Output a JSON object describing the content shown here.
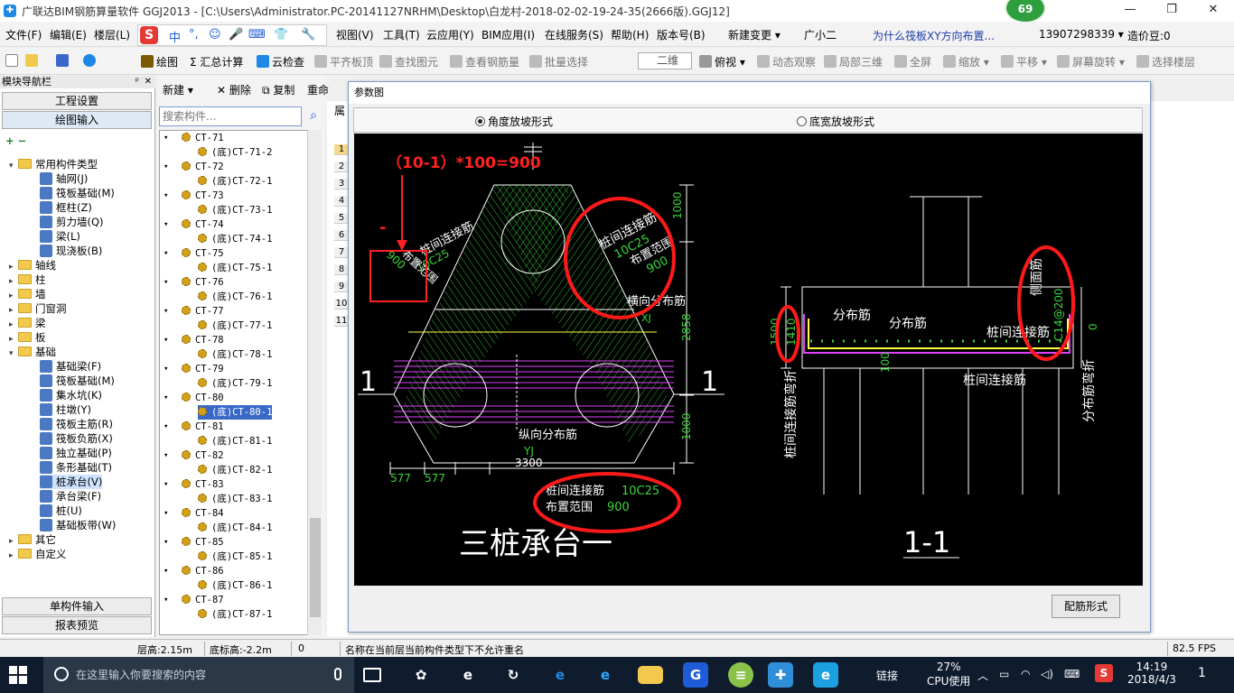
{
  "window": {
    "title": "广联达BIM钢筋算量软件 GGJ2013 - [C:\\Users\\Administrator.PC-20141127NRHM\\Desktop\\白龙村-2018-02-02-19-24-35(2666版).GGJ12]",
    "badge": "69",
    "minimize": "—",
    "maximize": "❐",
    "close": "✕"
  },
  "menu": {
    "items": [
      "文件(F)",
      "编辑(E)",
      "楼层(L)",
      "视图(V)",
      "工具(T)",
      "云应用(Y)",
      "BIM应用(I)",
      "在线服务(S)",
      "帮助(H)",
      "版本号(B)",
      "新建变更 ▾",
      "广小二"
    ],
    "ime": [
      "中",
      "°,",
      "☺",
      "🎤",
      "⌨",
      "👕",
      "🔧"
    ],
    "ime_logo": "S",
    "hint": "为什么筏板XY方向布置...",
    "phone": "13907298339 ▾",
    "cost_bean": "造价豆:0"
  },
  "toolbar": {
    "items": [
      "",
      "",
      "",
      "",
      "绘图",
      "Σ 汇总计算",
      "云检查",
      "平齐板顶",
      "查找图元",
      "查看钢筋量",
      "批量选择",
      "俯视 ▾",
      "动态观察",
      "局部三维",
      "全屏",
      "缩放 ▾",
      "平移 ▾",
      "屏幕旋转 ▾",
      "选择楼层"
    ],
    "view_mode": "二维"
  },
  "nav": {
    "header": "模块导航栏",
    "pin": "ᵖ",
    "close": "✕",
    "btn_project": "工程设置",
    "btn_draw": "绘图输入",
    "btn_single": "单构件输入",
    "btn_report": "报表预览",
    "expand_icons": "+ −",
    "tree": [
      {
        "label": "常用构件类型",
        "level": 0,
        "expanded": true,
        "folder": true
      },
      {
        "label": "轴网(J)",
        "level": 1
      },
      {
        "label": "筏板基础(M)",
        "level": 1
      },
      {
        "label": "框柱(Z)",
        "level": 1
      },
      {
        "label": "剪力墙(Q)",
        "level": 1
      },
      {
        "label": "梁(L)",
        "level": 1
      },
      {
        "label": "现浇板(B)",
        "level": 1
      },
      {
        "label": "轴线",
        "level": 0,
        "folder": true
      },
      {
        "label": "柱",
        "level": 0,
        "folder": true
      },
      {
        "label": "墙",
        "level": 0,
        "folder": true
      },
      {
        "label": "门窗洞",
        "level": 0,
        "folder": true
      },
      {
        "label": "梁",
        "level": 0,
        "folder": true
      },
      {
        "label": "板",
        "level": 0,
        "folder": true
      },
      {
        "label": "基础",
        "level": 0,
        "expanded": true,
        "folder": true
      },
      {
        "label": "基础梁(F)",
        "level": 1
      },
      {
        "label": "筏板基础(M)",
        "level": 1
      },
      {
        "label": "集水坑(K)",
        "level": 1
      },
      {
        "label": "柱墩(Y)",
        "level": 1
      },
      {
        "label": "筏板主筋(R)",
        "level": 1
      },
      {
        "label": "筏板负筋(X)",
        "level": 1
      },
      {
        "label": "独立基础(P)",
        "level": 1
      },
      {
        "label": "条形基础(T)",
        "level": 1
      },
      {
        "label": "桩承台(V)",
        "level": 1,
        "selected": true
      },
      {
        "label": "承台梁(F)",
        "level": 1
      },
      {
        "label": "桩(U)",
        "level": 1
      },
      {
        "label": "基础板带(W)",
        "level": 1
      },
      {
        "label": "其它",
        "level": 0,
        "folder": true
      },
      {
        "label": "自定义",
        "level": 0,
        "folder": true
      }
    ]
  },
  "components": {
    "new": "新建 ▾",
    "delete": "删除",
    "copy": "复制",
    "rename": "重命",
    "search_placeholder": "搜索构件...",
    "items": [
      {
        "label": "CT-71",
        "child": false
      },
      {
        "label": "(底)CT-71-2",
        "child": true
      },
      {
        "label": "CT-72",
        "child": false
      },
      {
        "label": "(底)CT-72-1",
        "child": true
      },
      {
        "label": "CT-73",
        "child": false
      },
      {
        "label": "(底)CT-73-1",
        "child": true
      },
      {
        "label": "CT-74",
        "child": false
      },
      {
        "label": "(底)CT-74-1",
        "child": true
      },
      {
        "label": "CT-75",
        "child": false
      },
      {
        "label": "(底)CT-75-1",
        "child": true
      },
      {
        "label": "CT-76",
        "child": false
      },
      {
        "label": "(底)CT-76-1",
        "child": true
      },
      {
        "label": "CT-77",
        "child": false
      },
      {
        "label": "(底)CT-77-1",
        "child": true
      },
      {
        "label": "CT-78",
        "child": false
      },
      {
        "label": "(底)CT-78-1",
        "child": true
      },
      {
        "label": "CT-79",
        "child": false
      },
      {
        "label": "(底)CT-79-1",
        "child": true
      },
      {
        "label": "CT-80",
        "child": false
      },
      {
        "label": "(底)CT-80-1",
        "child": true,
        "selected": true
      },
      {
        "label": "CT-81",
        "child": false
      },
      {
        "label": "(底)CT-81-1",
        "child": true
      },
      {
        "label": "CT-82",
        "child": false
      },
      {
        "label": "(底)CT-82-1",
        "child": true
      },
      {
        "label": "CT-83",
        "child": false
      },
      {
        "label": "(底)CT-83-1",
        "child": true
      },
      {
        "label": "CT-84",
        "child": false
      },
      {
        "label": "(底)CT-84-1",
        "child": true
      },
      {
        "label": "CT-85",
        "child": false
      },
      {
        "label": "(底)CT-85-1",
        "child": true
      },
      {
        "label": "CT-86",
        "child": false
      },
      {
        "label": "(底)CT-86-1",
        "child": true
      },
      {
        "label": "CT-87",
        "child": false
      },
      {
        "label": "(底)CT-87-1",
        "child": true
      }
    ]
  },
  "background": {
    "tab": "属",
    "rows": [
      "1",
      "2",
      "3",
      "4",
      "5",
      "6",
      "7",
      "8",
      "9",
      "10",
      "11"
    ]
  },
  "dialog": {
    "title": "参数图",
    "radio_angle": "角度放坡形式",
    "radio_width": "底宽放坡形式",
    "angle_selected": true,
    "button": "配筋形式",
    "drawing": {
      "annotation_formula": "（10-1）*100=900",
      "annotation_minus": "-",
      "left_section_mark": "1",
      "right_section_mark": "1",
      "label_link_bar": "桩间连接筋",
      "label_layout_range": "布置范围",
      "value_link_bar": "10C25",
      "value_range": "900",
      "label_transverse": "横向分布筋",
      "label_longitudinal": "纵向分布筋",
      "label_yj": "YJ",
      "label_xj": "XJ",
      "dim_1000_top": "1000",
      "dim_2858": "2858",
      "dim_1000_bottom": "1000",
      "dim_3300": "3300",
      "dim_577a": "577",
      "dim_577b": "577",
      "bottom_link_bar": "桩间连接筋",
      "bottom_link_value": "10C25",
      "bottom_range": "布置范围",
      "bottom_range_value": "900",
      "plan_title": "三桩承台一",
      "sec_dist1": "分布筋",
      "sec_dist2": "分布筋",
      "sec_link": "桩间连接筋",
      "sec_link2": "桩间连接筋",
      "sec_side": "侧面筋",
      "sec_side_value": "C14@200",
      "sec_1500": "1500",
      "sec_1410": "1410",
      "sec_100": "100",
      "sec_0": "0",
      "sec_left_vertical": "桩间连接筋弯折",
      "sec_right_vertical": "分布筋弯折",
      "section_title": "1-1"
    }
  },
  "status": {
    "floor_height": "层高:2.15m",
    "bottom_height": "底标高:-2.2m",
    "zero": "0",
    "message": "名称在当前层当前构件类型下不允许重名",
    "fps": "82.5 FPS"
  },
  "taskbar": {
    "search_placeholder": "在这里输入你要搜索的内容",
    "link": "链接",
    "cpu_percent": "27%",
    "cpu_label": "CPU使用",
    "time": "14:19",
    "date": "2018/4/3",
    "notify": "1"
  }
}
